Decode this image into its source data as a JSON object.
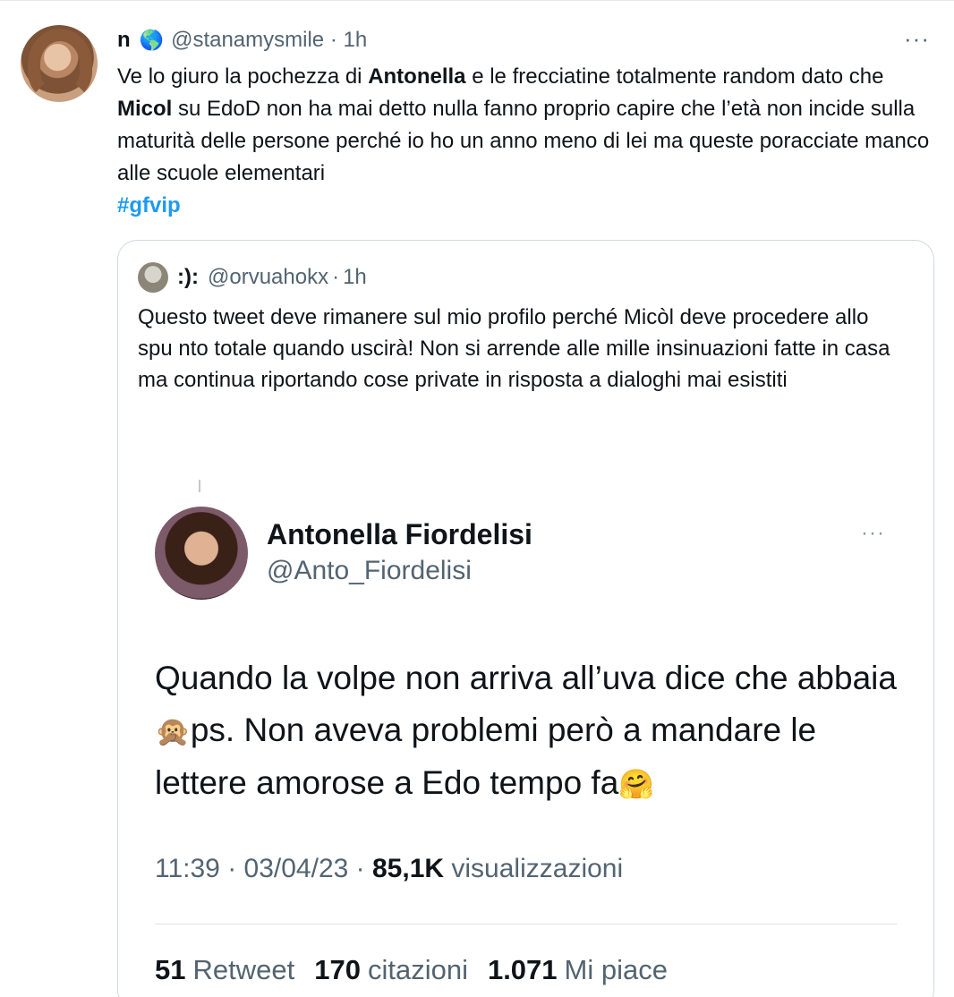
{
  "tweet": {
    "name": "n",
    "globe_icon": "globe-icon",
    "handle": "@stanamysmile",
    "time": "1h",
    "more": "···",
    "text_parts": [
      "Ve lo giuro la pochezza di ",
      "Antonella",
      " e le frecciatine totalmente random dato che ",
      "Micol",
      " su EdoD non ha mai detto nulla fanno proprio capire che l’età non incide sulla maturità delle persone perché io ho un anno meno di lei ma queste poracciate manco alle scuole elementari"
    ],
    "hashtag": "#gfvip"
  },
  "quote": {
    "name": ":):",
    "handle": "@orvuahokx",
    "time": "1h",
    "text": "Questo tweet deve rimanere sul mio profilo perché Micòl deve procedere allo spu             nto totale quando uscirà! Non si arrende alle mille insinuazioni fatte in casa ma continua riportando cose private in risposta a dialoghi mai esistiti",
    "screenshot": {
      "name": "Antonella Fiordelisi",
      "handle": "@Anto_Fiordelisi",
      "more": "···",
      "text_before_monkey": "Quando la volpe non arriva all’uva dice che abbaia",
      "monkey_emoji": "🙊",
      "text_after_monkey": "ps. Non aveva problemi però a mandare le lettere amorose a Edo tempo fa",
      "hug_emoji": "🤗",
      "time": "11:39",
      "date": "03/04/23",
      "views_count": "85,1K",
      "views_label": "visualizzazioni",
      "retweets_count": "51",
      "retweets_label": "Retweet",
      "quotes_count": "170",
      "quotes_label": "citazioni",
      "likes_count": "1.071",
      "likes_label": "Mi piace"
    }
  }
}
